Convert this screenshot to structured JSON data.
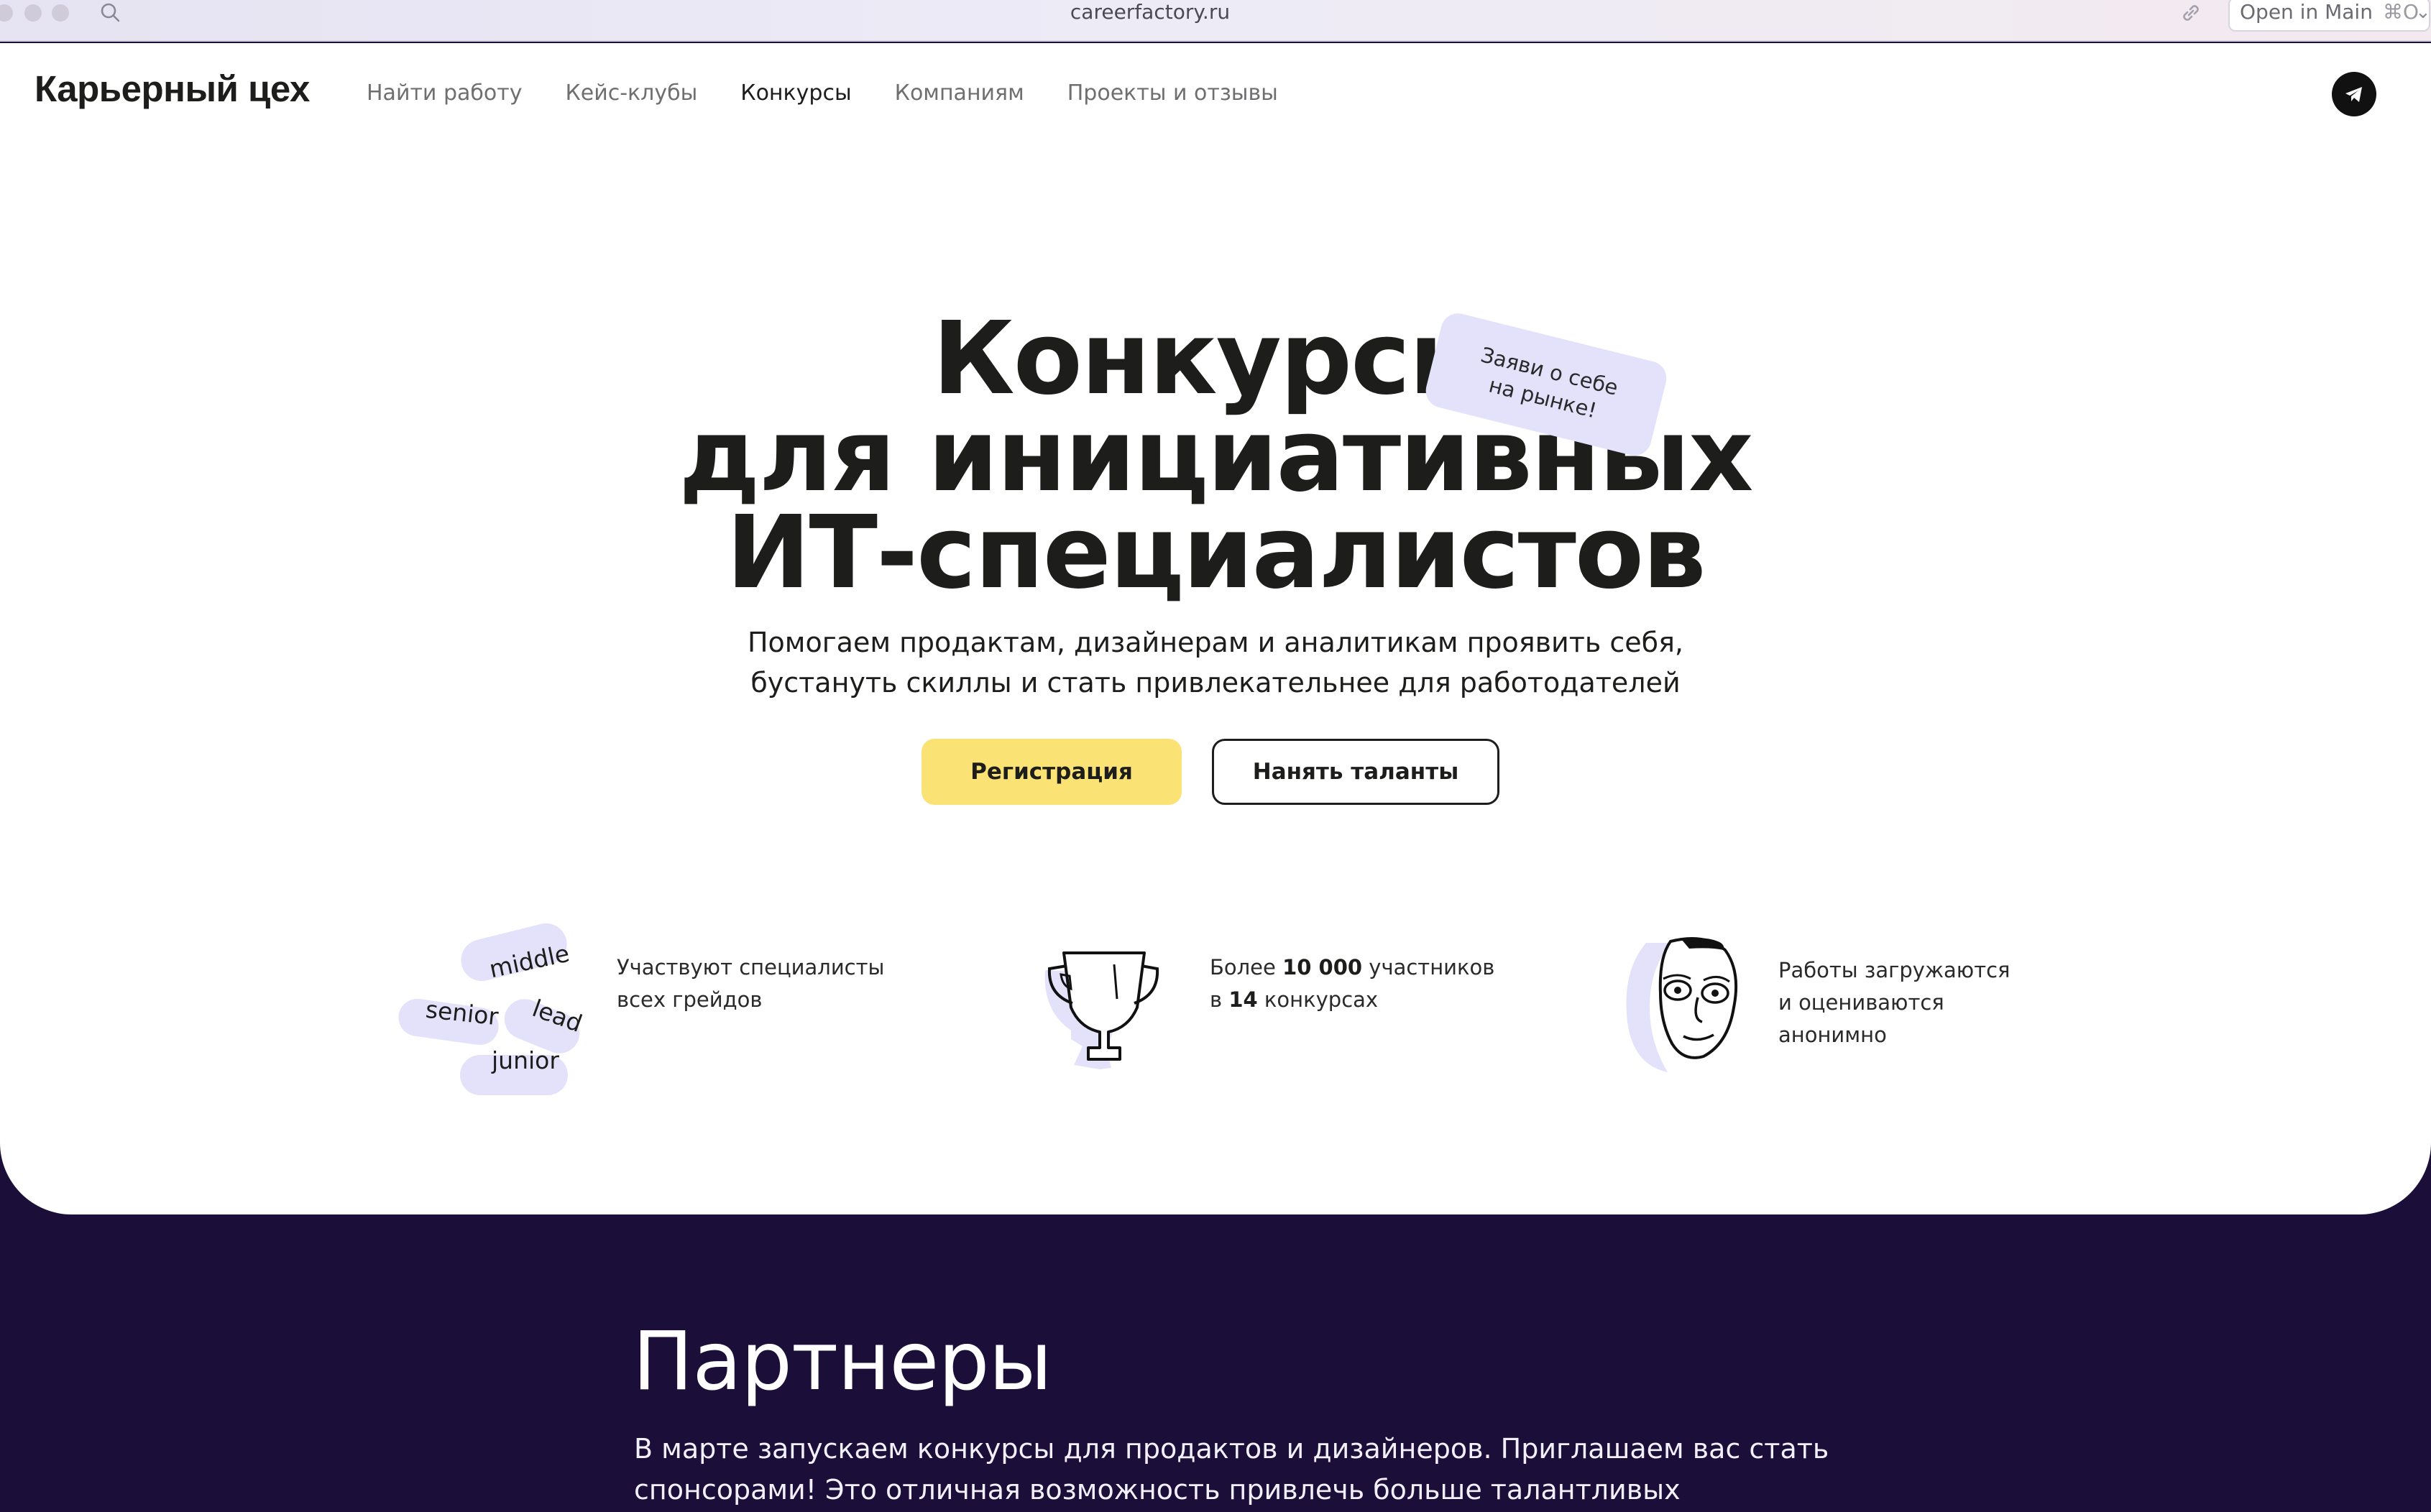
{
  "browser": {
    "url": "careerfactory.ru",
    "open_in_label": "Open in Main",
    "open_in_shortcut": "⌘O",
    "icons": [
      "search-icon",
      "link-icon",
      "chevron-icon"
    ]
  },
  "header": {
    "logo": "Карьерный цех",
    "nav": [
      {
        "label": "Найти работу",
        "active": false
      },
      {
        "label": "Кейс-клубы",
        "active": false
      },
      {
        "label": "Конкурсы",
        "active": true
      },
      {
        "label": "Компаниям",
        "active": false
      },
      {
        "label": "Проекты и отзывы",
        "active": false
      }
    ],
    "social_icon": "telegram-icon"
  },
  "hero": {
    "title_lines": [
      "Конкурсы",
      "для инициативных",
      "ИТ-специалистов"
    ],
    "sticker_lines": [
      "Заяви о себе",
      "на рынке!"
    ],
    "subtitle_lines": [
      "Помогаем продактам, дизайнерам и аналитикам проявить себя,",
      "бустануть скиллы и стать привлекательнее для работодателей"
    ],
    "primary_button": "Регистрация",
    "secondary_button": "Нанять таланты"
  },
  "features": [
    {
      "icon": "grades-icon",
      "grades": [
        "middle",
        "senior",
        "lead",
        "junior"
      ],
      "lines": [
        "Участвуют специалисты",
        "всех грейдов"
      ]
    },
    {
      "icon": "trophy-icon",
      "line1_prefix": "Более ",
      "line1_bold": "10 000",
      "line1_suffix": " участников",
      "line2_prefix": "в ",
      "line2_bold": "14",
      "line2_suffix": " конкурсах"
    },
    {
      "icon": "face-icon",
      "lines": [
        "Работы загружаются",
        "и оцениваются",
        "анонимно"
      ]
    }
  ],
  "partners": {
    "title": "Партнеры",
    "text_lines": [
      "В марте запускаем конкурсы для продактов и дизайнеров. Приглашаем вас стать",
      "спонсорами! Это отличная возможность привлечь больше талантливых кандидатов в вашу"
    ]
  },
  "colors": {
    "accent_yellow": "#fbe274",
    "dark_bg": "#1b0f3a",
    "lavender": "#e4e1fb",
    "text": "#1d1d1b"
  }
}
